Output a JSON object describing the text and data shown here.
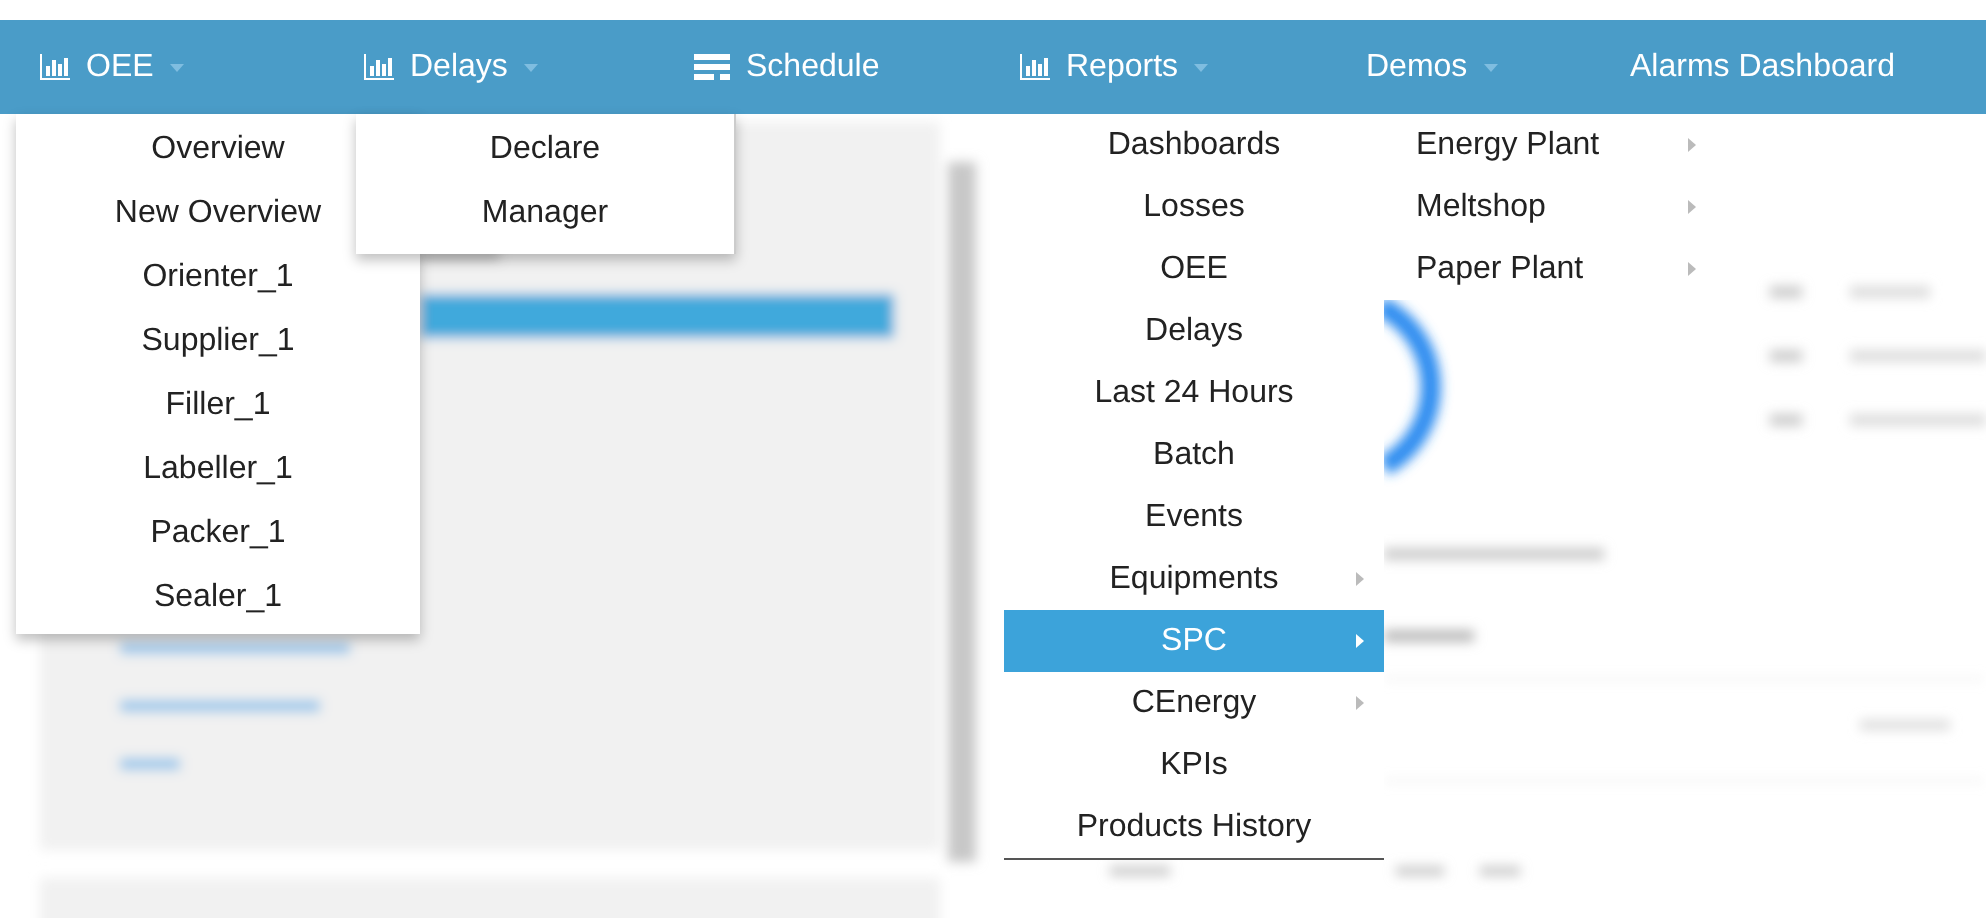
{
  "navbar": {
    "items": [
      {
        "label": "OEE",
        "kind": "chart",
        "caret": true,
        "menu": [
          {
            "label": "Overview",
            "selected": false,
            "submenu": false
          },
          {
            "label": "New Overview",
            "selected": false,
            "submenu": false
          },
          {
            "label": "Orienter_1",
            "selected": false,
            "submenu": false
          },
          {
            "label": "Supplier_1",
            "selected": false,
            "submenu": false
          },
          {
            "label": "Filler_1",
            "selected": false,
            "submenu": false
          },
          {
            "label": "Labeller_1",
            "selected": false,
            "submenu": false
          },
          {
            "label": "Packer_1",
            "selected": false,
            "submenu": false
          },
          {
            "label": "Sealer_1",
            "selected": false,
            "submenu": false
          }
        ]
      },
      {
        "label": "Delays",
        "kind": "chart",
        "caret": true,
        "menu": [
          {
            "label": "Declare",
            "selected": false,
            "submenu": false
          },
          {
            "label": "Manager",
            "selected": false,
            "submenu": false
          }
        ]
      },
      {
        "label": "Schedule",
        "kind": "schedule",
        "caret": false
      },
      {
        "label": "Reports",
        "kind": "chart",
        "caret": true,
        "menu": [
          {
            "label": "Dashboards",
            "selected": false,
            "submenu": false
          },
          {
            "label": "Losses",
            "selected": false,
            "submenu": false
          },
          {
            "label": "OEE",
            "selected": false,
            "submenu": false
          },
          {
            "label": "Delays",
            "selected": false,
            "submenu": false
          },
          {
            "label": "Last 24 Hours",
            "selected": false,
            "submenu": false
          },
          {
            "label": "Batch",
            "selected": false,
            "submenu": false
          },
          {
            "label": "Events",
            "selected": false,
            "submenu": false
          },
          {
            "label": "Equipments",
            "selected": false,
            "submenu": true
          },
          {
            "label": "SPC",
            "selected": true,
            "submenu": true
          },
          {
            "label": "CEnergy",
            "selected": false,
            "submenu": true
          },
          {
            "label": "KPIs",
            "selected": false,
            "submenu": false
          },
          {
            "label": "Products History",
            "selected": false,
            "submenu": false
          }
        ]
      },
      {
        "label": "Demos",
        "kind": "plain",
        "caret": true,
        "menu": [
          {
            "label": "Energy Plant",
            "selected": false,
            "submenu": true
          },
          {
            "label": "Meltshop",
            "selected": false,
            "submenu": true
          },
          {
            "label": "Paper Plant",
            "selected": false,
            "submenu": true
          }
        ]
      },
      {
        "label": "Alarms Dashboard",
        "kind": "plain",
        "caret": false
      }
    ]
  }
}
